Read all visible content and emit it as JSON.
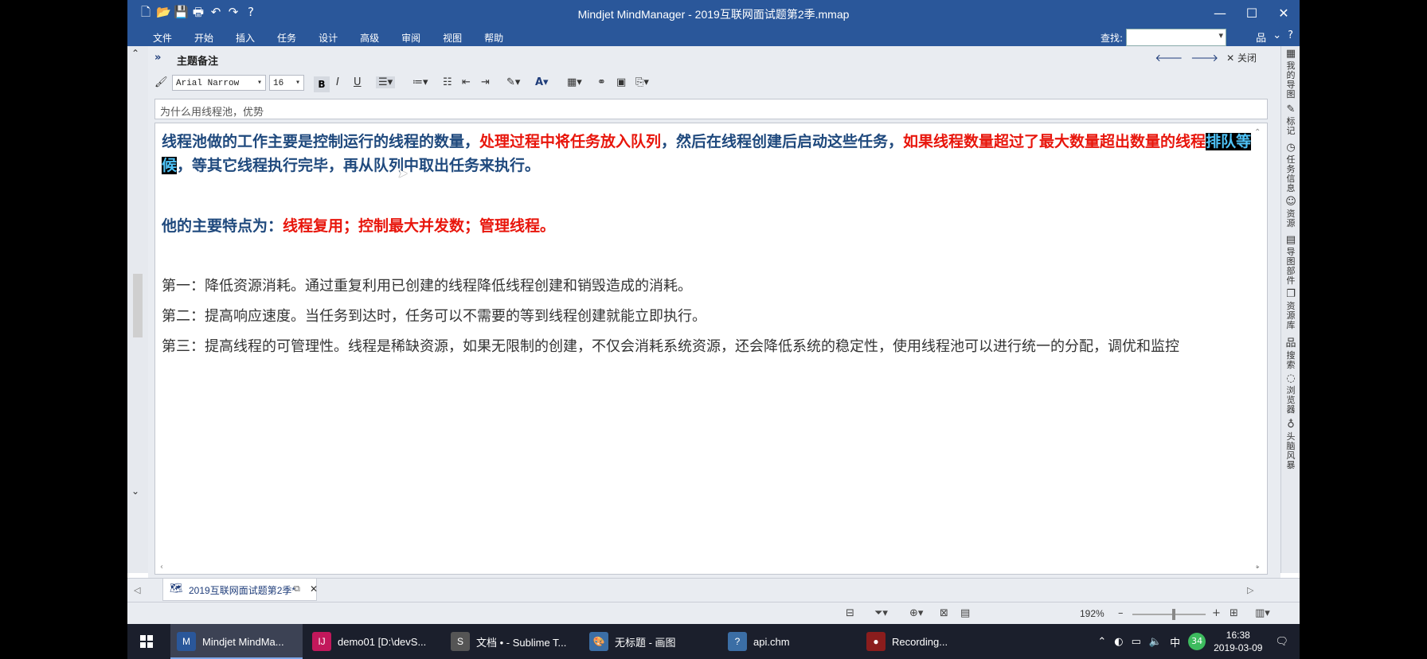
{
  "window": {
    "title": "Mindjet MindManager - 2019互联网面试题第2季.mmap",
    "minimize": "—",
    "maximize": "☐",
    "close": "✕"
  },
  "qat": [
    "🗋",
    "📂",
    "💾",
    "🖶",
    "↶",
    "↷",
    "?"
  ],
  "ribbon": {
    "tabs": [
      "文件",
      "开始",
      "插入",
      "任务",
      "设计",
      "高级",
      "审阅",
      "视图",
      "帮助"
    ],
    "find_label": "查找:",
    "find_value": ""
  },
  "notes": {
    "header_title": "主题备注",
    "nav_back": "🡐",
    "nav_forward": "🡒",
    "close_label": "✕ 关闭",
    "font_name": "Arial Narrow",
    "font_size": "16",
    "bold": "B",
    "italic": "I",
    "underline": "U",
    "subject": "为什么用线程池，优势",
    "p1": {
      "a": "线程池做的工作主要是控制运行的线程的数量，",
      "b": "处理过程中将任务放入队列",
      "c": "，然后在线程创建后启动这些任务，",
      "d": "如果线程数量超过了最大数量超出数量的线程",
      "e": "排队等候",
      "f": "，等其它线程执行完毕，再从队列中取出任务来执行。"
    },
    "p2": {
      "a": "他的主要特点为：",
      "b": "线程复用；控制最大并发数；管理线程。"
    },
    "p3": "第一：降低资源消耗。通过重复利用已创建的线程降低线程创建和销毁造成的消耗。",
    "p4": "第二：提高响应速度。当任务到达时，任务可以不需要的等到线程创建就能立即执行。",
    "p5": "第三：提高线程的可管理性。线程是稀缺资源，如果无限制的创建，不仅会消耗系统资源，还会降低系统的稳定性，使用线程池可以进行统一的分配，调优和监控"
  },
  "right_panel": [
    {
      "icon": "▦",
      "label": "我的导图"
    },
    {
      "icon": "✎",
      "label": "标记"
    },
    {
      "icon": "◷",
      "label": "任务信息"
    },
    {
      "icon": "☺",
      "label": "资源"
    },
    {
      "icon": "▤",
      "label": "导图部件"
    },
    {
      "icon": "❐",
      "label": "资源库"
    },
    {
      "icon": "品",
      "label": "搜索"
    },
    {
      "icon": "◌",
      "label": "浏览器"
    },
    {
      "icon": "♁",
      "label": "头脑风暴"
    }
  ],
  "doc_tab": {
    "label": "2019互联网面试题第2季*"
  },
  "status": {
    "zoom": "192%"
  },
  "taskbar": {
    "items": [
      {
        "label": "Mindjet MindMa...",
        "icon": "M",
        "color": "#2A579A"
      },
      {
        "label": "demo01 [D:\\devS...",
        "icon": "IJ",
        "color": "#C2185B"
      },
      {
        "label": "文档 • - Sublime T...",
        "icon": "S",
        "color": "#555555"
      },
      {
        "label": "无标题 - 画图",
        "icon": "🎨",
        "color": "#3b6ea5"
      },
      {
        "label": "api.chm",
        "icon": "?",
        "color": "#3b6ea5"
      },
      {
        "label": "Recording...",
        "icon": "●",
        "color": "#8b1d1d"
      }
    ],
    "tray_ime": "中",
    "tray_badge": "34",
    "time": "16:38",
    "date": "2019-03-09"
  }
}
